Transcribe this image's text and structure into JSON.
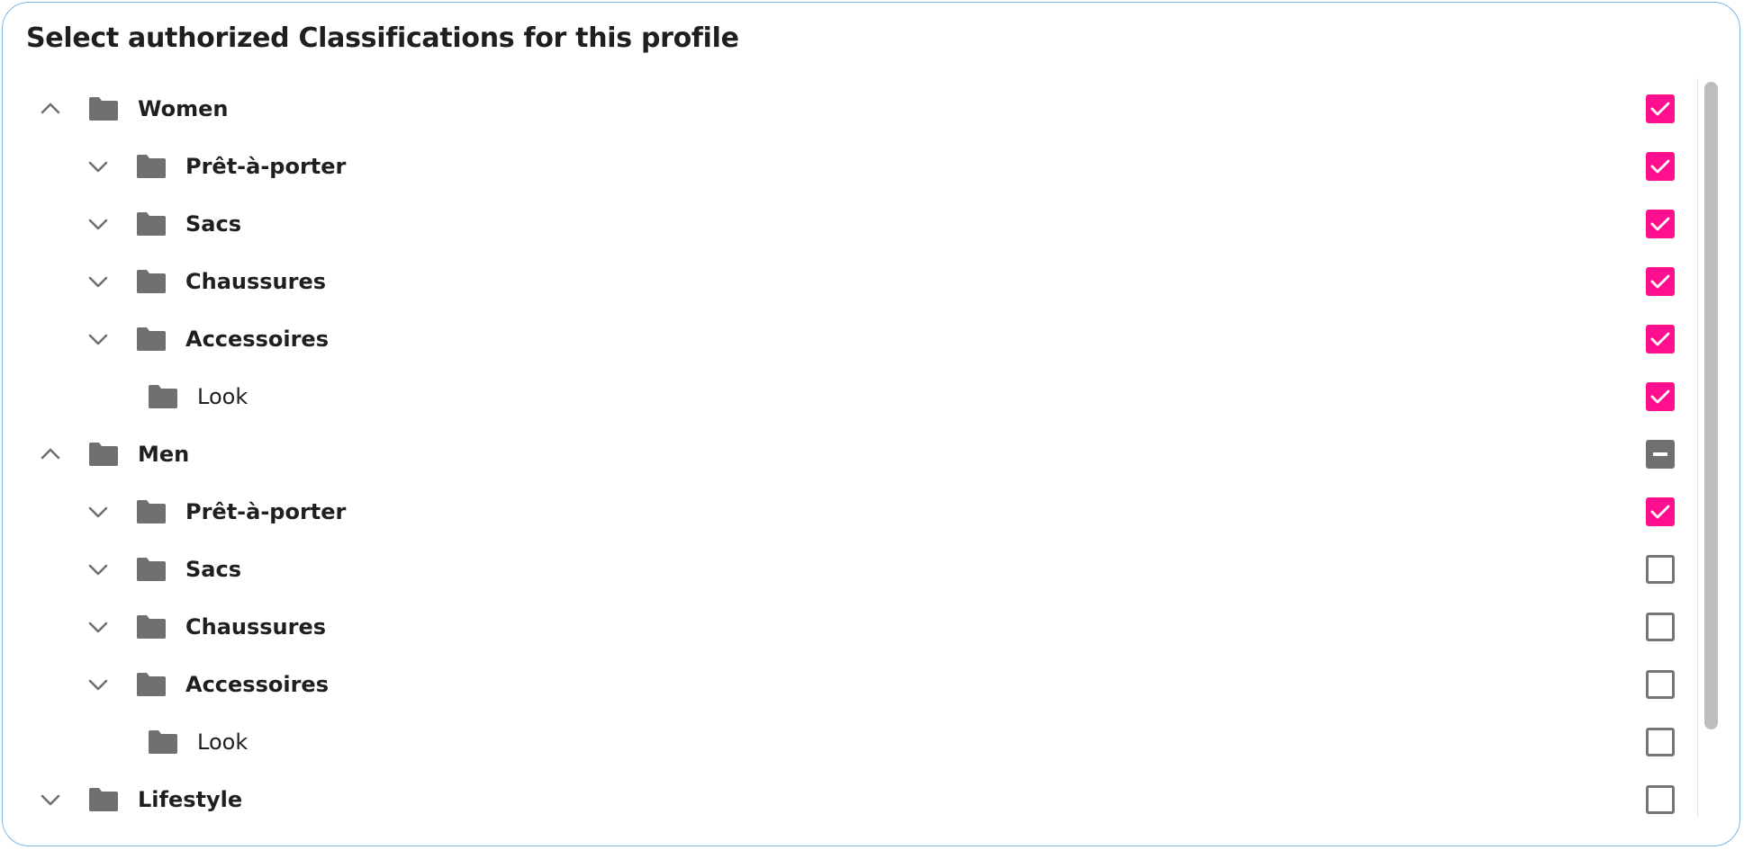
{
  "title": "Select authorized Classifications for this profile",
  "colors": {
    "accent": "#ff0f8e",
    "icon": "#707070",
    "border": "#7fb7e3"
  },
  "icons": {
    "folder": "folder-icon",
    "expanded": "chevron-up-icon",
    "collapsed": "chevron-down-icon",
    "checked": "check-icon",
    "partial": "minus-icon"
  },
  "tree": [
    {
      "label": "Women",
      "level": 0,
      "bold": true,
      "chevron": "up",
      "state": "checked"
    },
    {
      "label": "Prêt-à-porter",
      "level": 1,
      "bold": true,
      "chevron": "down",
      "state": "checked"
    },
    {
      "label": "Sacs",
      "level": 1,
      "bold": true,
      "chevron": "down",
      "state": "checked"
    },
    {
      "label": "Chaussures",
      "level": 1,
      "bold": true,
      "chevron": "down",
      "state": "checked"
    },
    {
      "label": "Accessoires",
      "level": 1,
      "bold": true,
      "chevron": "down",
      "state": "checked"
    },
    {
      "label": "Look",
      "level": 2,
      "bold": false,
      "chevron": "none",
      "state": "checked"
    },
    {
      "label": "Men",
      "level": 0,
      "bold": true,
      "chevron": "up",
      "state": "partial"
    },
    {
      "label": "Prêt-à-porter",
      "level": 1,
      "bold": true,
      "chevron": "down",
      "state": "checked"
    },
    {
      "label": "Sacs",
      "level": 1,
      "bold": true,
      "chevron": "down",
      "state": "unchecked"
    },
    {
      "label": "Chaussures",
      "level": 1,
      "bold": true,
      "chevron": "down",
      "state": "unchecked"
    },
    {
      "label": "Accessoires",
      "level": 1,
      "bold": true,
      "chevron": "down",
      "state": "unchecked"
    },
    {
      "label": "Look",
      "level": 2,
      "bold": false,
      "chevron": "none",
      "state": "unchecked"
    },
    {
      "label": "Lifestyle",
      "level": 0,
      "bold": true,
      "chevron": "down",
      "state": "unchecked"
    }
  ]
}
